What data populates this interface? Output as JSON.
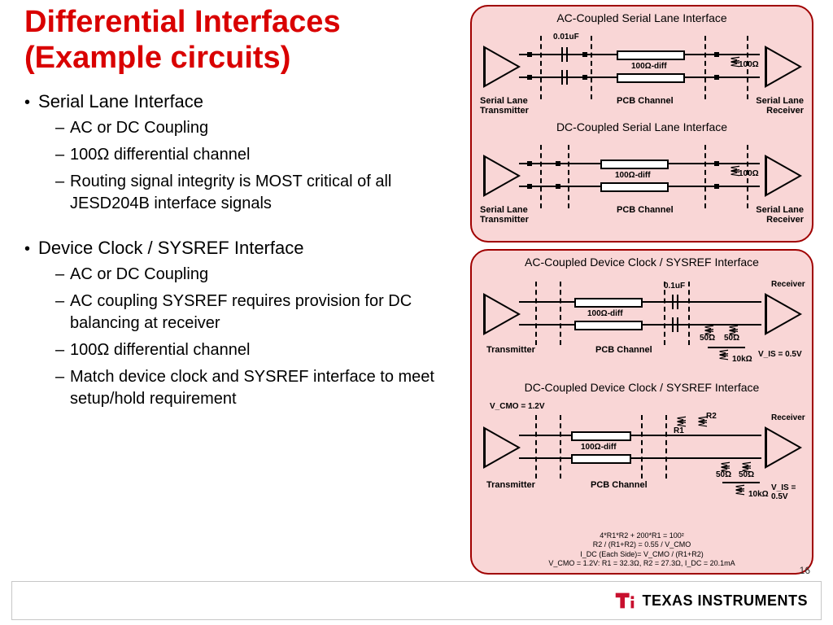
{
  "title_line1": "Differential Interfaces",
  "title_line2": "(Example circuits)",
  "bullets": {
    "b1": "Serial Lane Interface",
    "b1s1": "AC or DC Coupling",
    "b1s2": "100Ω differential channel",
    "b1s3": "Routing signal integrity is MOST critical of all JESD204B interface signals",
    "b2": "Device Clock / SYSREF Interface",
    "b2s1": "AC or DC Coupling",
    "b2s2": "AC coupling SYSREF requires provision for DC balancing at receiver",
    "b2s3": "100Ω differential channel",
    "b2s4": "Match device clock and SYSREF interface to meet setup/hold requirement"
  },
  "fig1": {
    "title_ac": "AC-Coupled Serial Lane Interface",
    "title_dc": "DC-Coupled Serial Lane Interface",
    "cap_val": "0.01uF",
    "diff_imp": "100Ω-diff",
    "term_imp": "100Ω",
    "tx_label": "Serial Lane Transmitter",
    "rx_label": "Serial Lane Receiver",
    "pcb_label": "PCB Channel"
  },
  "fig2": {
    "title_ac": "AC-Coupled Device Clock / SYSREF Interface",
    "title_dc": "DC-Coupled Device Clock / SYSREF Interface",
    "cap_val": "0.1uF",
    "diff_imp": "100Ω-diff",
    "term50": "50Ω",
    "r10k": "10kΩ",
    "vis": "V_IS = 0.5V",
    "vcmo": "V_CMO = 1.2V",
    "r1": "R1",
    "r2": "R2",
    "tx_label": "Transmitter",
    "rx_label": "Receiver",
    "pcb_label": "PCB Channel",
    "eq1": "4*R1*R2 + 200*R1 = 100²",
    "eq2": "R2 / (R1+R2) = 0.55 / V_CMO",
    "eq3": "I_DC (Each Side)= V_CMO / (R1+R2)",
    "eq4": "V_CMO = 1.2V: R1 = 32.3Ω, R2 = 27.3Ω, I_DC = 20.1mA"
  },
  "footer": {
    "brand": "TEXAS INSTRUMENTS"
  },
  "page_num": "16"
}
